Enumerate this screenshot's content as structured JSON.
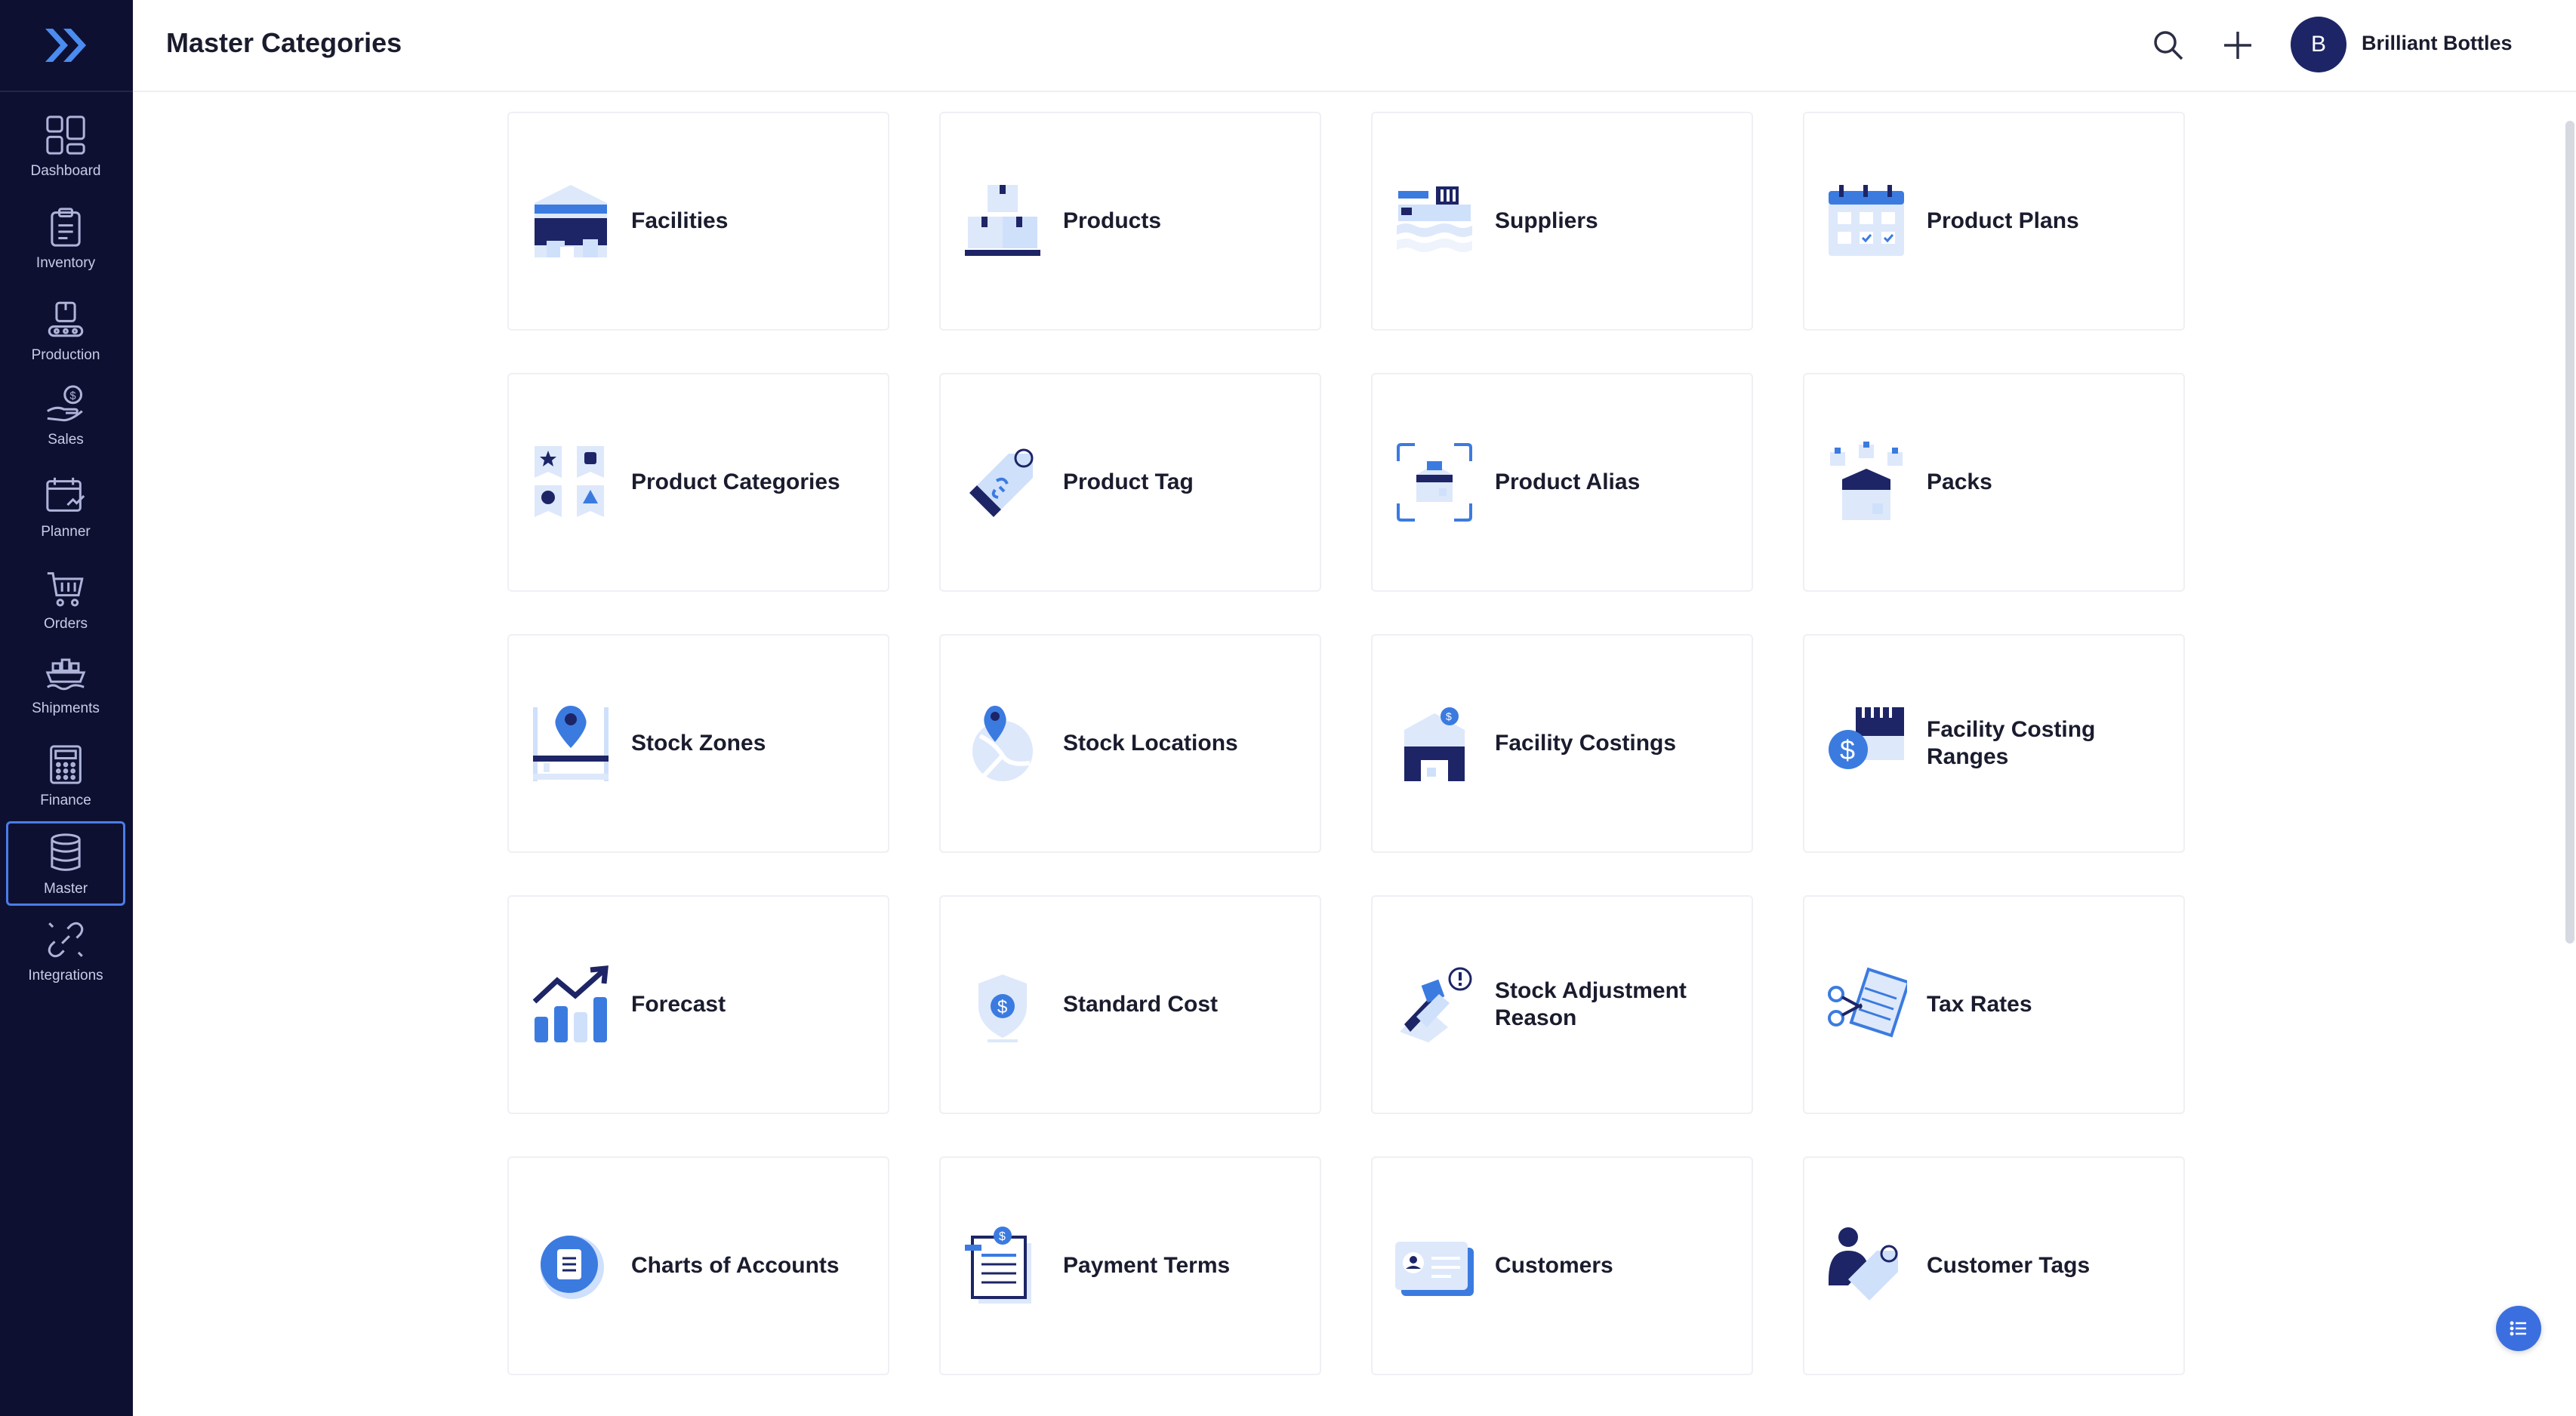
{
  "app": {
    "page_title": "Master Categories",
    "account_initial": "B",
    "account_name": "Brilliant Bottles"
  },
  "colors": {
    "sidebar_bg": "#0e1032",
    "accent": "#3b6fe0",
    "icon_dark": "#1d2566",
    "icon_light": "#cfe0fb"
  },
  "sidebar": {
    "items": [
      {
        "label": "Dashboard",
        "icon": "dashboard-icon"
      },
      {
        "label": "Inventory",
        "icon": "inventory-icon"
      },
      {
        "label": "Production",
        "icon": "production-icon"
      },
      {
        "label": "Sales",
        "icon": "sales-icon"
      },
      {
        "label": "Planner",
        "icon": "planner-icon"
      },
      {
        "label": "Orders",
        "icon": "cart-icon"
      },
      {
        "label": "Shipments",
        "icon": "ship-icon"
      },
      {
        "label": "Finance",
        "icon": "calculator-icon"
      },
      {
        "label": "Master",
        "icon": "database-icon",
        "active": true
      },
      {
        "label": "Integrations",
        "icon": "link-icon"
      }
    ]
  },
  "cards": [
    {
      "label": "Facilities",
      "icon": "warehouse-icon"
    },
    {
      "label": "Products",
      "icon": "boxes-icon"
    },
    {
      "label": "Suppliers",
      "icon": "cargo-ship-icon"
    },
    {
      "label": "Product Plans",
      "icon": "calendar-icon"
    },
    {
      "label": "Product Categories",
      "icon": "categories-icon"
    },
    {
      "label": "Product Tag",
      "icon": "tag-icon"
    },
    {
      "label": "Product Alias",
      "icon": "alias-box-icon"
    },
    {
      "label": "Packs",
      "icon": "packs-icon"
    },
    {
      "label": "Stock Zones",
      "icon": "map-pin-shelf-icon"
    },
    {
      "label": "Stock Locations",
      "icon": "location-globe-icon"
    },
    {
      "label": "Facility Costings",
      "icon": "facility-cost-icon"
    },
    {
      "label": "Facility Costing Ranges",
      "icon": "cost-range-icon"
    },
    {
      "label": "Forecast",
      "icon": "forecast-chart-icon"
    },
    {
      "label": "Standard Cost",
      "icon": "shield-dollar-icon"
    },
    {
      "label": "Stock Adjustment Reason",
      "icon": "adjustment-icon"
    },
    {
      "label": "Tax Rates",
      "icon": "tax-scissors-icon"
    },
    {
      "label": "Charts of Accounts",
      "icon": "document-badge-icon"
    },
    {
      "label": "Payment Terms",
      "icon": "invoice-dollar-icon"
    },
    {
      "label": "Customers",
      "icon": "id-card-icon"
    },
    {
      "label": "Customer Tags",
      "icon": "customer-tag-icon"
    }
  ]
}
